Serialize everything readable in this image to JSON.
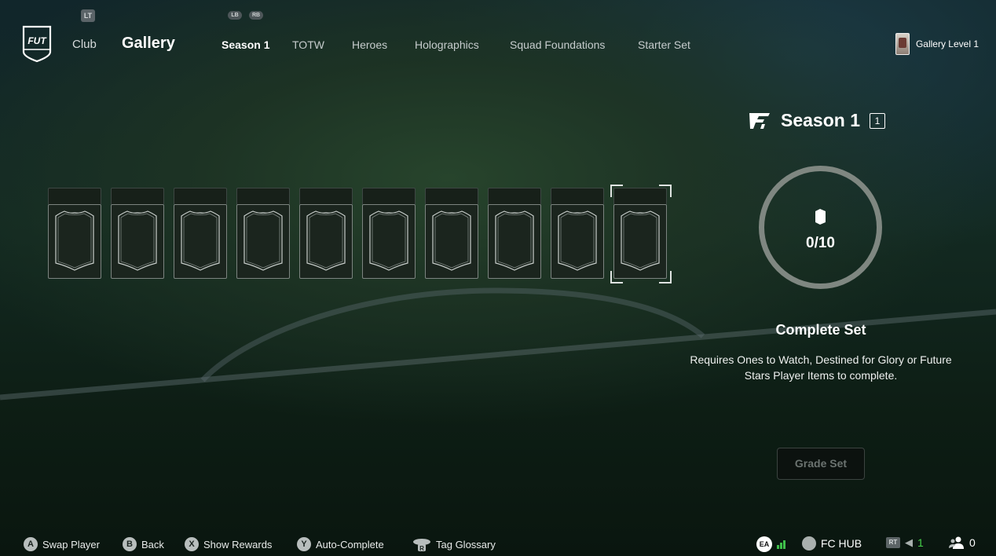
{
  "header": {
    "lt_label": "LT",
    "lb_label": "LB",
    "rb_label": "RB",
    "logo_text": "FUT",
    "club_label": "Club",
    "gallery_label": "Gallery",
    "tabs": [
      {
        "label": "Season 1",
        "active": true
      },
      {
        "label": "TOTW",
        "active": false
      },
      {
        "label": "Heroes",
        "active": false
      },
      {
        "label": "Holographics",
        "active": false
      },
      {
        "label": "Squad Foundations",
        "active": false
      },
      {
        "label": "Starter Set",
        "active": false
      }
    ],
    "gallery_level": "Gallery Level 1"
  },
  "set": {
    "title": "Season 1",
    "count_badge": "1",
    "collected": 0,
    "total": 10,
    "progress_text": "0/10",
    "complete_title": "Complete Set",
    "requirement": "Requires Ones to Watch, Destined for Glory or Future Stars Player Items to complete.",
    "grade_button": "Grade Set",
    "slots_count": 10,
    "selected_slot": 10
  },
  "footer": {
    "hints": [
      {
        "button": "A",
        "label": "Swap Player"
      },
      {
        "button": "B",
        "label": "Back"
      },
      {
        "button": "X",
        "label": "Show Rewards"
      },
      {
        "button": "Y",
        "label": "Auto-Complete"
      },
      {
        "button": "R",
        "label": "Tag Glossary"
      }
    ],
    "ea_label": "EA",
    "fc_hub_label": "FC HUB",
    "rt_label": "RT",
    "notifications": "1",
    "friends": "0"
  },
  "colors": {
    "accent_green": "#45d04a",
    "ring": "#7f8781"
  }
}
